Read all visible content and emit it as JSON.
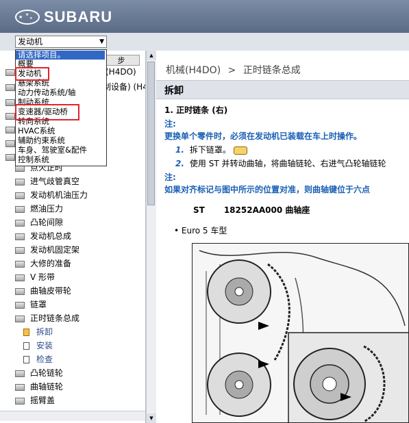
{
  "header": {
    "brand": "SUBARU"
  },
  "selector": {
    "value": "发动机"
  },
  "dropdown": {
    "items": [
      "请选择项目。",
      "概要",
      "发动机",
      "悬架系统",
      "动力传动系统/轴",
      "制动系统",
      "变速器/驱动桥",
      "转向系统",
      "HVAC系统",
      "辅助约束系统",
      "车身、驾驶室&配件",
      "控制系统"
    ],
    "selected": "请选择项目。"
  },
  "sync_button": {
    "label": "步"
  },
  "tree": {
    "partial_1": "(H4DO)",
    "partial_2": "制设备) (H4",
    "items": [
      "点火正时",
      "进气歧管真空",
      "发动机机油压力",
      "燃油压力",
      "凸轮间隙",
      "发动机总成",
      "发动机固定架",
      "大修的准备",
      "V 形带",
      "曲轴皮带轮",
      "链罩",
      "正时链条总成",
      "拆卸",
      "安装",
      "检查",
      "凸轮链轮",
      "曲轴链轮",
      "摇臂盖"
    ]
  },
  "main": {
    "breadcrumb": {
      "part1": "机械(H4DO)",
      "separator": ">",
      "part2": "正时链条总成"
    },
    "section_title": "拆卸",
    "heading": "1.  正时链条 (右)",
    "note_label_1": "注:",
    "note_1": "更换单个零件时，必须在发动机已装载在车上时操作。",
    "step1_num": "1.",
    "step1_text": "拆下链罩。",
    "step2_num": "2.",
    "step2_text": "使用 ST 并转动曲轴，将曲轴链轮、右进气凸轮轴链轮",
    "note_label_2": "注:",
    "note_2": "如果对齐标记与图中所示的位置对准，则曲轴键位于六点",
    "tool_st": "ST",
    "tool_part": "18252AA000 曲轴座",
    "euro": "Euro 5 车型"
  },
  "colors": {
    "header": "#6b7c97",
    "accent_blue": "#1a5fb4",
    "highlight_red": "#e0242b",
    "selection": "#3168c6"
  }
}
